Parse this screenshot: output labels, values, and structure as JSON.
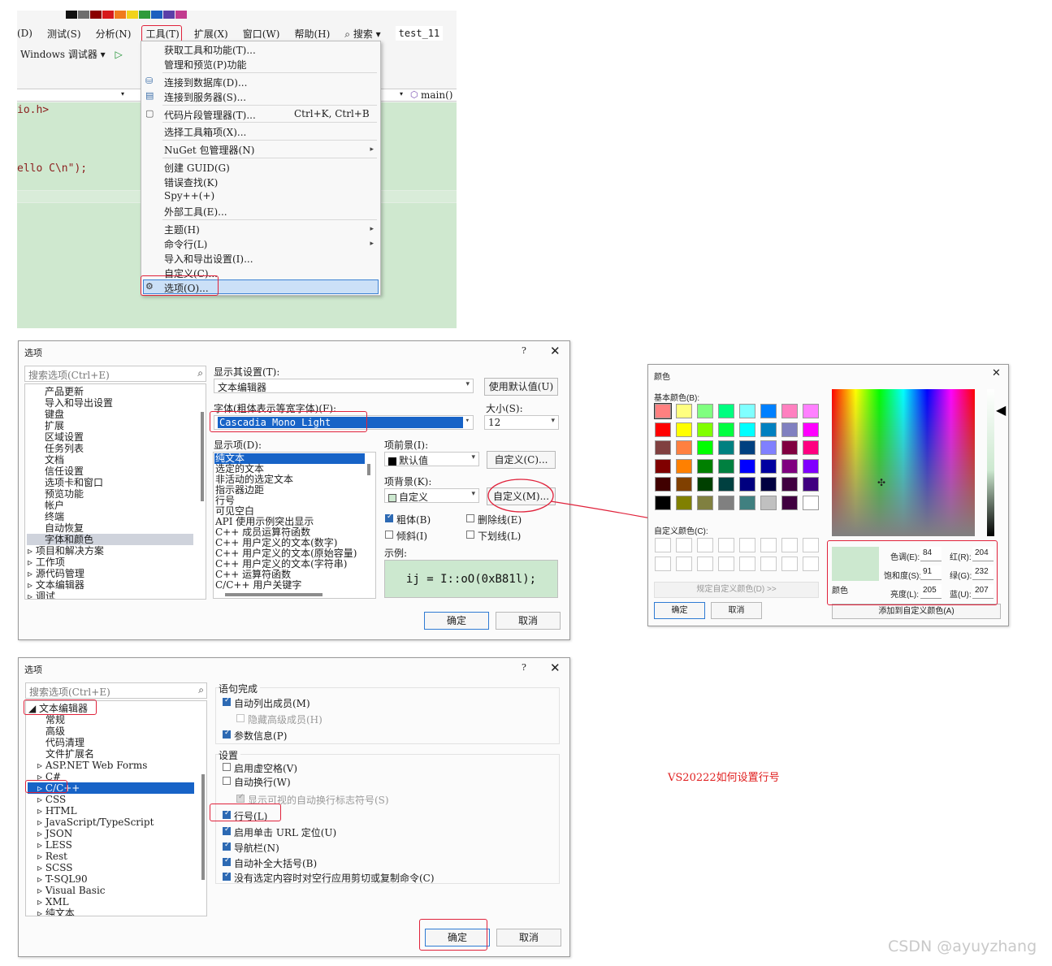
{
  "ide": {
    "menubar": [
      "(D)",
      "测试(S)",
      "分析(N)",
      "工具(T)",
      "扩展(X)",
      "窗口(W)",
      "帮助(H)",
      "⌕ 搜索 ▾",
      "test_11"
    ],
    "toolbar_text": "Windows 调试器 ▾",
    "nav_member": "main()",
    "code": [
      "io.h>",
      "ello C\\n\");"
    ],
    "palette": [
      "#111111",
      "#6e6e6e",
      "#8b0000",
      "#d7191c",
      "#f07b1d",
      "#f2d31b",
      "#2e9b3b",
      "#1c5fbf",
      "#5b3fa8",
      "#c23b8f"
    ]
  },
  "tools_menu": {
    "items": [
      {
        "label": "获取工具和功能(T)..."
      },
      {
        "label": "管理和预览(P)功能"
      },
      {
        "label": "连接到数据库(D)...",
        "icon": "database-icon"
      },
      {
        "label": "连接到服务器(S)...",
        "icon": "server-icon"
      },
      {
        "label": "代码片段管理器(T)...",
        "shortcut": "Ctrl+K, Ctrl+B",
        "icon": "snippet-icon"
      },
      {
        "label": "选择工具箱项(X)..."
      },
      {
        "label": "NuGet 包管理器(N)",
        "submenu": true
      },
      {
        "label": "创建 GUID(G)"
      },
      {
        "label": "错误查找(K)"
      },
      {
        "label": "Spy++(+)"
      },
      {
        "label": "外部工具(E)..."
      },
      {
        "label": "主题(H)",
        "submenu": true
      },
      {
        "label": "命令行(L)",
        "submenu": true
      },
      {
        "label": "导入和导出设置(I)..."
      },
      {
        "label": "自定义(C)..."
      },
      {
        "label": "选项(O)...",
        "selected": true,
        "icon": "gear-icon"
      }
    ]
  },
  "options_fonts": {
    "title": "选项",
    "help": "?",
    "close": "✕",
    "search_placeholder": "搜索选项(Ctrl+E)",
    "tree": [
      "产品更新",
      "导入和导出设置",
      "键盘",
      "扩展",
      "区域设置",
      "任务列表",
      "文档",
      "信任设置",
      "选项卡和窗口",
      "预览功能",
      "帐户",
      "终端",
      "自动恢复",
      "字体和颜色",
      "▹ 项目和解决方案",
      "▹ 工作项",
      "▹ 源代码管理",
      "▹ 文本编辑器",
      "▹ 调试"
    ],
    "show_settings_label": "显示其设置(T):",
    "show_settings_value": "文本编辑器",
    "use_defaults": "使用默认值(U)",
    "font_label": "字体(粗体表示等宽字体)(F):",
    "font_value": "Cascadia Mono Light",
    "size_label": "大小(S):",
    "size_value": "12",
    "display_items_label": "显示项(D):",
    "display_items": [
      "纯文本",
      "选定的文本",
      "非活动的选定文本",
      "指示器边距",
      "行号",
      "可见空白",
      "API 使用示例突出显示",
      "C++ 成员运算符函数",
      "C++ 用户定义的文本(数字)",
      "C++ 用户定义的文本(原始容量)",
      "C++ 用户定义的文本(字符串)",
      "C++ 运算符函数",
      "C/C++ 用户关键字"
    ],
    "fg_label": "项前景(I):",
    "fg_value": "默认值",
    "fg_custom": "自定义(C)...",
    "bg_label": "项背景(K):",
    "bg_value": "自定义",
    "bg_custom": "自定义(M)...",
    "bold": "粗体(B)",
    "italic": "倾斜(I)",
    "strike": "删除线(E)",
    "underline": "下划线(L)",
    "sample_label": "示例:",
    "sample_text": "ij = I::oO(0xB81l);",
    "ok": "确定",
    "cancel": "取消"
  },
  "color_dialog": {
    "title": "颜色",
    "close": "✕",
    "basic_label": "基本颜色(B):",
    "basic_colors": [
      "#ff8080",
      "#ffff80",
      "#80ff80",
      "#00ff80",
      "#80ffff",
      "#0080ff",
      "#ff80c0",
      "#ff80ff",
      "#ff0000",
      "#ffff00",
      "#80ff00",
      "#00ff40",
      "#00ffff",
      "#0080c0",
      "#8080c0",
      "#ff00ff",
      "#804040",
      "#ff8040",
      "#00ff00",
      "#008080",
      "#004080",
      "#8080ff",
      "#800040",
      "#ff0080",
      "#800000",
      "#ff8000",
      "#008000",
      "#008040",
      "#0000ff",
      "#0000a0",
      "#800080",
      "#8000ff",
      "#400000",
      "#804000",
      "#004000",
      "#004040",
      "#000080",
      "#000040",
      "#400040",
      "#400080",
      "#000000",
      "#808000",
      "#808040",
      "#808080",
      "#408080",
      "#c0c0c0",
      "#400040",
      "#ffffff"
    ],
    "custom_label": "自定义颜色(C):",
    "define_custom": "规定自定义颜色(D) >>",
    "ok": "确定",
    "cancel": "取消",
    "add_custom": "添加到自定义颜色(A)",
    "color_label": "颜色",
    "preview_color": "#cce8cf",
    "hue_label": "色调(E):",
    "hue": "84",
    "sat_label": "饱和度(S):",
    "sat": "91",
    "lum_label": "亮度(L):",
    "lum": "205",
    "red_label": "红(R):",
    "red": "204",
    "green_label": "绿(G):",
    "green": "232",
    "blue_label": "蓝(U):",
    "blue": "207"
  },
  "options_editor": {
    "title": "选项",
    "help": "?",
    "close": "✕",
    "search_placeholder": "搜索选项(Ctrl+E)",
    "tree": [
      "◢ 文本编辑器",
      "常规",
      "高级",
      "代码清理",
      "文件扩展名",
      "▹ ASP.NET Web Forms",
      "▹ C#",
      "▹ C/C++",
      "▹ CSS",
      "▹ HTML",
      "▹ JavaScript/TypeScript",
      "▹ JSON",
      "▹ LESS",
      "▹ Rest",
      "▹ SCSS",
      "▹ T-SQL90",
      "▹ Visual Basic",
      "▹ XML",
      "▹ 纯文本"
    ],
    "statement_completion": "语句完成",
    "auto_list_members": "自动列出成员(M)",
    "hide_advanced": "隐藏高级成员(H)",
    "param_info": "参数信息(P)",
    "settings": "设置",
    "virtual_space": "启用虚空格(V)",
    "word_wrap": "自动换行(W)",
    "visual_glyphs": "显示可视的自动换行标志符号(S)",
    "line_numbers": "行号(L)",
    "single_click_url": "启用单击 URL 定位(U)",
    "nav_bar": "导航栏(N)",
    "auto_brace": "自动补全大括号(B)",
    "apply_cut_copy": "没有选定内容时对空行应用剪切或复制命令(C)",
    "ok": "确定",
    "cancel": "取消"
  },
  "caption": "VS20222如何设置行号",
  "watermark": "CSDN @ayuyzhang"
}
